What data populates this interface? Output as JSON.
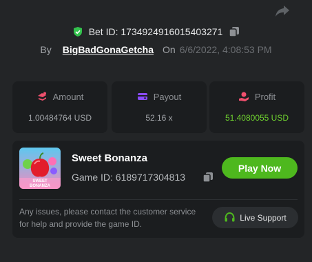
{
  "header": {
    "bet_label": "Bet ID:",
    "bet_id": "173492491601540327​1",
    "by_label": "By",
    "username": "BigBadGonaGetcha",
    "on_label": "On",
    "date": "6/6/2022, 4:08:53 PM"
  },
  "stats": [
    {
      "label": "Amount",
      "value": "1.00484764 USD",
      "icon": "amount-icon",
      "icon_color": "#f0506e"
    },
    {
      "label": "Payout",
      "value": "52.16 x",
      "icon": "payout-icon",
      "icon_color": "#8a4bff"
    },
    {
      "label": "Profit",
      "value": "51.4080055 USD",
      "icon": "profit-icon",
      "icon_color": "#f0506e"
    }
  ],
  "game": {
    "name": "Sweet Bonanza",
    "id_label": "Game ID:",
    "id": "6189717304813",
    "thumb_text": "SWEET BONANZA",
    "play_label": "Play Now",
    "notice": "Any issues, please contact the customer service for help and provide the game ID.",
    "support_label": "Live Support"
  },
  "colors": {
    "background": "#232527",
    "card": "#1b1d1f",
    "accent_green": "#4eb81e",
    "profit_green": "#6fd22f",
    "shield_green": "#33c24d"
  }
}
